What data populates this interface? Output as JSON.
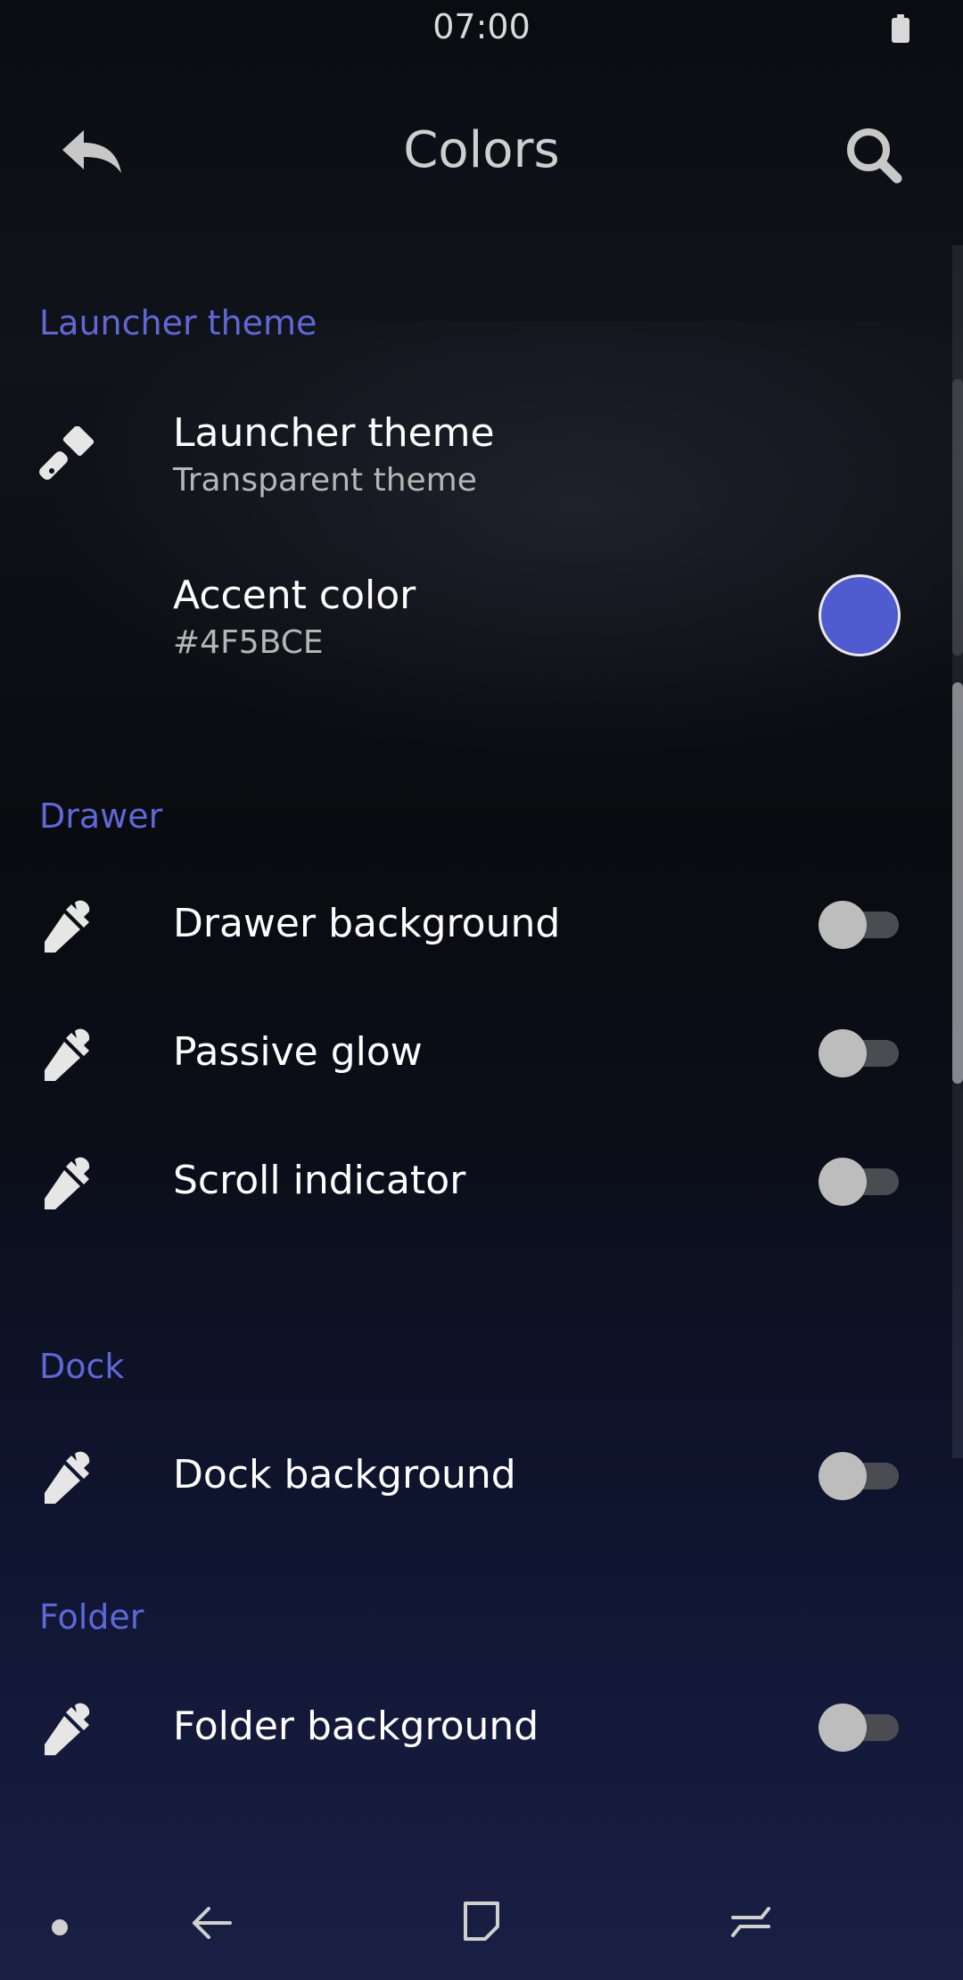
{
  "status_bar": {
    "time": "07:00",
    "battery_icon": "battery-full-icon"
  },
  "toolbar": {
    "title": "Colors",
    "back_icon": "reply-arrow-icon",
    "search_icon": "search-icon"
  },
  "sections": {
    "launcher_theme": {
      "header": "Launcher theme",
      "theme_row": {
        "title": "Launcher theme",
        "subtitle": "Transparent theme",
        "icon": "paintbrush-icon"
      },
      "accent_row": {
        "title": "Accent color",
        "subtitle": "#4F5BCE",
        "swatch_color": "#4F5BCE"
      }
    },
    "drawer": {
      "header": "Drawer",
      "items": [
        {
          "title": "Drawer background",
          "icon": "eyedropper-icon",
          "enabled": false
        },
        {
          "title": "Passive glow",
          "icon": "eyedropper-icon",
          "enabled": false
        },
        {
          "title": "Scroll indicator",
          "icon": "eyedropper-icon",
          "enabled": false
        }
      ]
    },
    "dock": {
      "header": "Dock",
      "items": [
        {
          "title": "Dock background",
          "icon": "eyedropper-icon",
          "enabled": false
        }
      ]
    },
    "folder": {
      "header": "Folder",
      "items": [
        {
          "title": "Folder background",
          "icon": "eyedropper-icon",
          "enabled": false
        }
      ]
    }
  },
  "colors": {
    "accent": "#4F5BCE",
    "section_header": "#5F68D6",
    "toggle_off_thumb": "#BDBDBD",
    "toggle_off_track": "#4A4C52"
  },
  "nav_bar": {
    "dot_icon": "nav-dot-icon",
    "back_icon": "nav-back-icon",
    "home_icon": "nav-home-icon",
    "recents_icon": "nav-recents-icon"
  }
}
